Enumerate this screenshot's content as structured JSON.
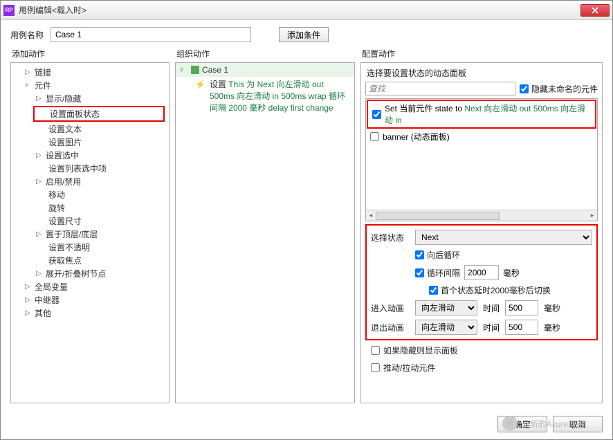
{
  "window": {
    "title": "用例编辑<载入时>",
    "logo_text": "RP"
  },
  "case_name": {
    "label": "用例名称",
    "value": "Case 1"
  },
  "add_condition": "添加条件",
  "headers": {
    "add_action": "添加动作",
    "organize": "组织动作",
    "configure": "配置动作"
  },
  "tree": {
    "link": "链接",
    "widget": "元件",
    "show_hide": "显示/隐藏",
    "set_panel_state": "设置面板状态",
    "set_text": "设置文本",
    "set_image": "设置图片",
    "set_selected": "设置选中",
    "set_list_option": "设置列表选中项",
    "enable_disable": "启用/禁用",
    "move": "移动",
    "rotate": "旋转",
    "set_size": "设置尺寸",
    "bring_front": "置于顶层/底层",
    "set_opacity": "设置不透明",
    "get_focus": "获取焦点",
    "tree_collapse": "展开/折叠树节点",
    "global_var": "全局变量",
    "repeater": "中继器",
    "other": "其他"
  },
  "org": {
    "case": "Case 1",
    "action_prefix": "设置 ",
    "action_this": "This 为 Next 向左滑动 out 500ms 向左滑动 in 500ms wrap 循环间隔 2000 毫秒 delay first change"
  },
  "cfg": {
    "select_panel": "选择要设置状态的动态面板",
    "search_placeholder": "查找",
    "hide_unnamed": "隐藏未命名的元件",
    "item1_pre": "Set 当前元件 state to ",
    "item1_green": "Next 向左滑动 out 500ms 向左滑动 in",
    "item2": "banner (动态面板)",
    "select_state": "选择状态",
    "state_value": "Next",
    "wrap": "向后循环",
    "repeat_label": "循环间隔",
    "repeat_value": "2000",
    "ms": "毫秒",
    "delay_first": "首个状态延时2000毫秒后切换",
    "anim_in": "进入动画",
    "anim_out": "退出动画",
    "anim_type": "向左滑动",
    "time_label": "时间",
    "time_value": "500",
    "show_if_hidden": "如果隐藏则显示面板",
    "push_pull": "推动/拉动元件"
  },
  "footer": {
    "ok": "确定",
    "cancel": "取消"
  },
  "watermark": "艾斯的Axure峡谷"
}
